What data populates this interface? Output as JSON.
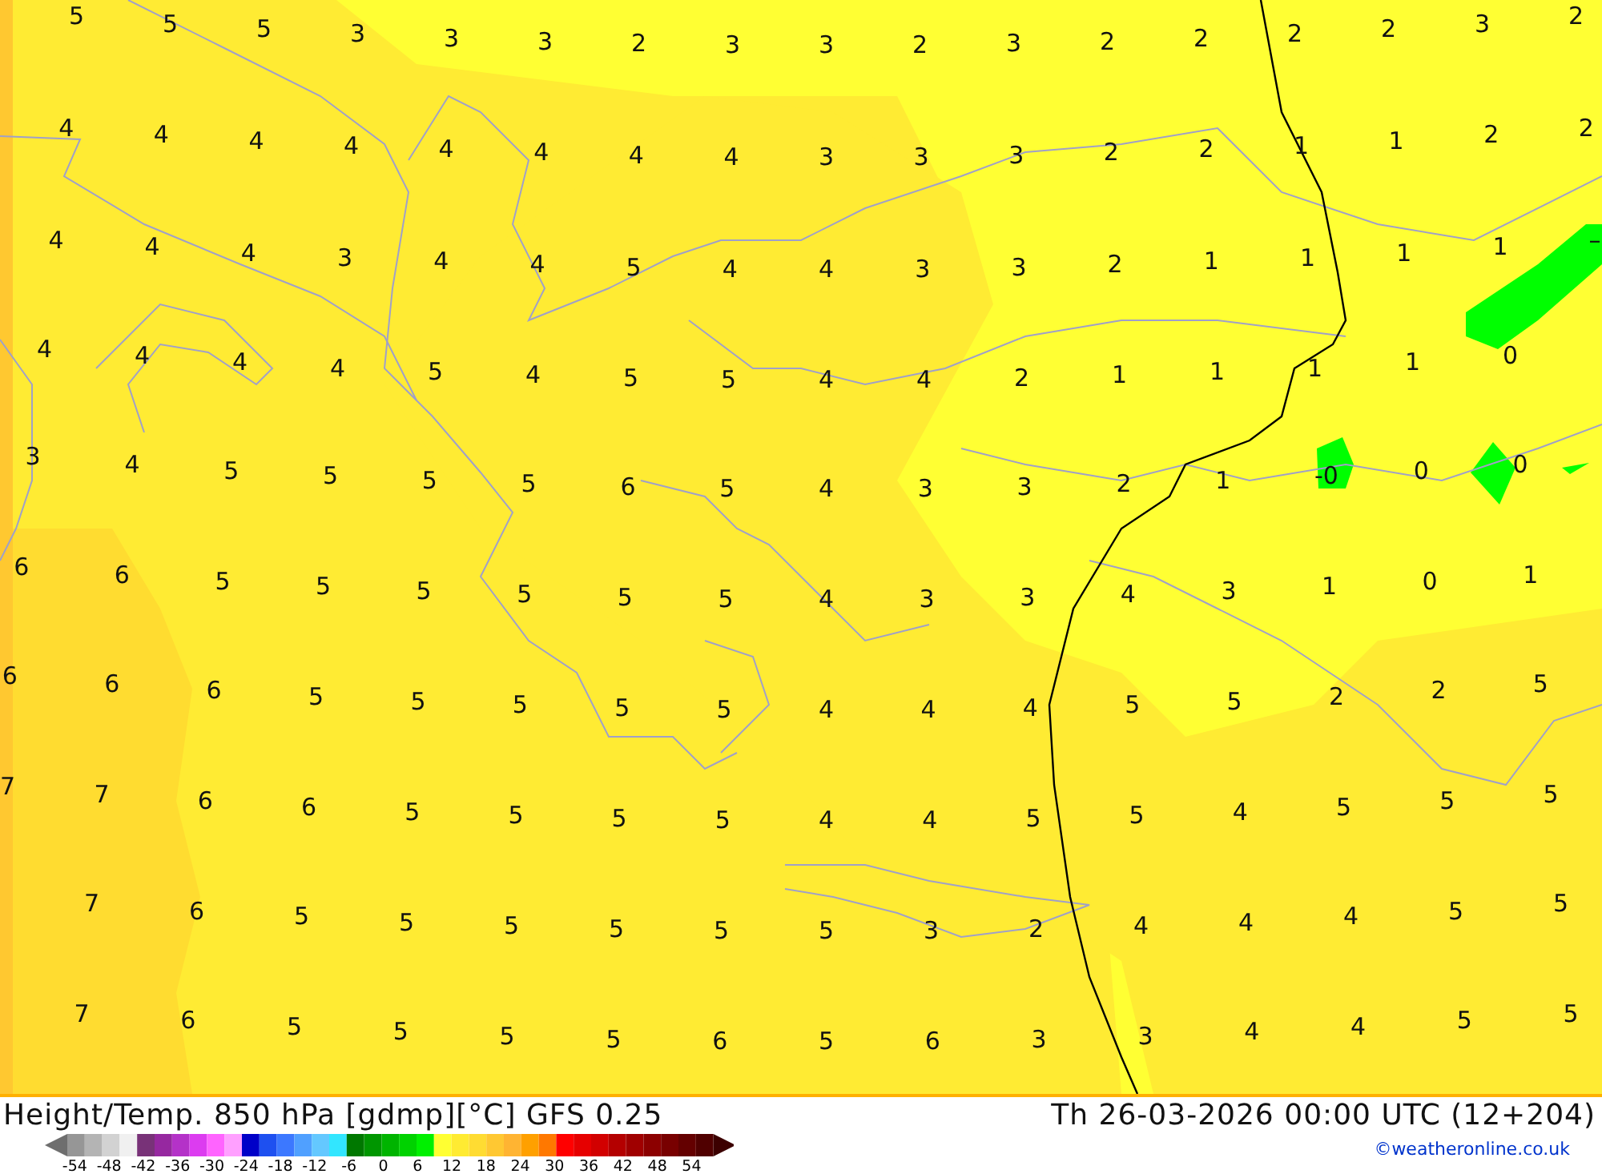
{
  "map": {
    "rows": [
      [
        "5",
        "5",
        "5",
        "3",
        "3",
        "3",
        "2",
        "3",
        "3",
        "2",
        "3",
        "2",
        "2",
        "2",
        "2",
        "3",
        "2"
      ],
      [
        "4",
        "4",
        "4",
        "4",
        "4",
        "4",
        "4",
        "4",
        "3",
        "3",
        "3",
        "2",
        "2",
        "1",
        "1",
        "2",
        "2"
      ],
      [
        "4",
        "4",
        "4",
        "3",
        "4",
        "4",
        "5",
        "4",
        "4",
        "3",
        "3",
        "2",
        "1",
        "1",
        "1",
        "1",
        "–"
      ],
      [
        "4",
        "4",
        "4",
        "4",
        "5",
        "4",
        "5",
        "5",
        "4",
        "4",
        "2",
        "1",
        "1",
        "1",
        "1",
        "0"
      ],
      [
        "3",
        "4",
        "5",
        "5",
        "5",
        "5",
        "6",
        "5",
        "4",
        "3",
        "3",
        "2",
        "1",
        "-0",
        "0",
        "0"
      ],
      [
        "6",
        "6",
        "5",
        "5",
        "5",
        "5",
        "5",
        "5",
        "4",
        "3",
        "3",
        "4",
        "3",
        "1",
        "0",
        "1"
      ],
      [
        "6",
        "6",
        "6",
        "5",
        "5",
        "5",
        "5",
        "5",
        "4",
        "4",
        "4",
        "5",
        "5",
        "2",
        "2",
        "5"
      ],
      [
        "7",
        "7",
        "6",
        "6",
        "5",
        "5",
        "5",
        "5",
        "4",
        "4",
        "5",
        "5",
        "4",
        "5",
        "5",
        "5"
      ],
      [
        "7",
        "6",
        "5",
        "5",
        "5",
        "5",
        "5",
        "5",
        "3",
        "2",
        "4",
        "4",
        "4",
        "5",
        "5"
      ],
      [
        "7",
        "6",
        "5",
        "5",
        "5",
        "5",
        "6",
        "5",
        "6",
        "3",
        "3",
        "4",
        "4",
        "5",
        "5"
      ]
    ]
  },
  "footer": {
    "title": "Height/Temp. 850 hPa [gdmp][°C] GFS 0.25",
    "datetime": "Th 26-03-2026 00:00 UTC (12+204)",
    "credit": "©weatheronline.co.uk"
  },
  "legend": {
    "swatches": [
      {
        "color": "#6e6e6e"
      },
      {
        "color": "#969696"
      },
      {
        "color": "#b4b4b4"
      },
      {
        "color": "#d2d2d2"
      },
      {
        "color": "#f0f0f0"
      },
      {
        "color": "#783278"
      },
      {
        "color": "#9628a0"
      },
      {
        "color": "#b432c8"
      },
      {
        "color": "#dc3cf0"
      },
      {
        "color": "#ff64ff"
      },
      {
        "color": "#ffa0ff"
      },
      {
        "color": "#0000c8"
      },
      {
        "color": "#1e50f0"
      },
      {
        "color": "#3c78ff"
      },
      {
        "color": "#50a0ff"
      },
      {
        "color": "#64c8ff"
      },
      {
        "color": "#32e6ff"
      },
      {
        "color": "#007800"
      },
      {
        "color": "#009600"
      },
      {
        "color": "#00b400"
      },
      {
        "color": "#00d200"
      },
      {
        "color": "#00f000"
      },
      {
        "color": "#ffff32"
      },
      {
        "color": "#ffeb32"
      },
      {
        "color": "#ffdc32"
      },
      {
        "color": "#ffc832"
      },
      {
        "color": "#ffb432"
      },
      {
        "color": "#ffa000"
      },
      {
        "color": "#ff7800"
      },
      {
        "color": "#ff0000"
      },
      {
        "color": "#e60000"
      },
      {
        "color": "#d20000"
      },
      {
        "color": "#b40000"
      },
      {
        "color": "#a00000"
      },
      {
        "color": "#8c0000"
      },
      {
        "color": "#780000"
      },
      {
        "color": "#640000"
      },
      {
        "color": "#500000"
      },
      {
        "color": "#3c0000"
      }
    ],
    "ticks": [
      "-54",
      "-48",
      "-42",
      "-36",
      "-30",
      "-24",
      "-18",
      "-12",
      "-6",
      "0",
      "6",
      "12",
      "18",
      "24",
      "30",
      "36",
      "42",
      "48",
      "54"
    ]
  }
}
